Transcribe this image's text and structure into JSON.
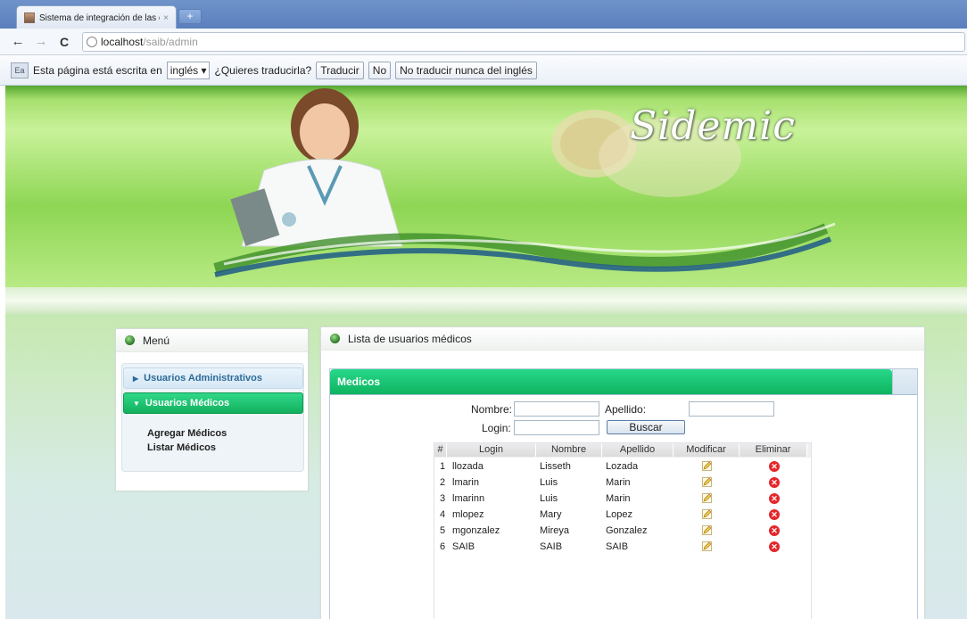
{
  "browser": {
    "tab_title": "Sistema de integración de las e",
    "tab_close": "×",
    "new_tab": "+",
    "back": "←",
    "forward": "→",
    "reload": "C",
    "url_host": "localhost",
    "url_path": "/saib/admin"
  },
  "translate_bar": {
    "icon_text": "Ea",
    "message": "Esta página está escrita en",
    "language": "inglés ▾",
    "question": "¿Quieres traducirla?",
    "translate_btn": "Traducir",
    "no_btn": "No",
    "never_btn": "No traducir nunca del inglés"
  },
  "banner": {
    "logo": "Sidemic"
  },
  "menu": {
    "title": "Menú",
    "items": [
      {
        "label": "Usuarios Administrativos",
        "arrow": "▶"
      },
      {
        "label": "Usuarios Médicos",
        "arrow": "▼"
      }
    ],
    "subitems": [
      "Agregar Médicos",
      "Listar Médicos"
    ]
  },
  "main": {
    "title": "Lista de usuarios médicos",
    "tab": "Medicos",
    "form": {
      "nombre_label": "Nombre:",
      "apellido_label": "Apellido:",
      "login_label": "Login:",
      "search_btn": "Buscar",
      "nombre_value": "",
      "apellido_value": "",
      "login_value": ""
    },
    "table": {
      "columns": [
        "#",
        "Login",
        "Nombre",
        "Apellido",
        "Modificar",
        "Eliminar"
      ],
      "rows": [
        {
          "n": "1",
          "login": "llozada",
          "nombre": "Lisseth",
          "apellido": "Lozada"
        },
        {
          "n": "2",
          "login": "lmarin",
          "nombre": "Luis",
          "apellido": "Marin"
        },
        {
          "n": "3",
          "login": "lmarinn",
          "nombre": "Luis",
          "apellido": "Marin"
        },
        {
          "n": "4",
          "login": "mlopez",
          "nombre": "Mary",
          "apellido": "Lopez"
        },
        {
          "n": "5",
          "login": "mgonzalez",
          "nombre": "Mireya",
          "apellido": "Gonzalez"
        },
        {
          "n": "6",
          "login": "SAIB",
          "nombre": "SAIB",
          "apellido": "SAIB"
        }
      ]
    }
  },
  "colors": {
    "accent_green": "#12b05e",
    "menu_blue": "#2e6b9a",
    "delete_red": "#e3262a"
  }
}
